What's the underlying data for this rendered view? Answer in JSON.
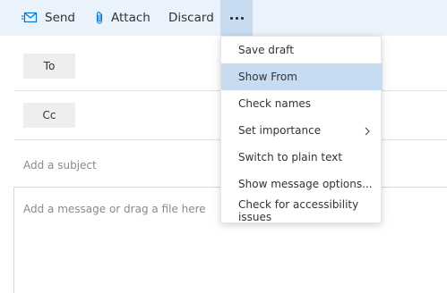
{
  "toolbar": {
    "send_label": "Send",
    "send_icon": "send-icon",
    "attach_label": "Attach",
    "attach_icon": "paperclip-icon",
    "discard_label": "Discard",
    "more_icon": "more-options-icon",
    "accent_color": "#0078d4",
    "background_color": "#eaf2fb"
  },
  "compose": {
    "to_label": "To",
    "cc_label": "Cc",
    "subject_placeholder": "Add a subject",
    "body_placeholder": "Add a message or drag a file here"
  },
  "menu": {
    "items": [
      {
        "label": "Save draft"
      },
      {
        "label": "Show From",
        "highlighted": true
      },
      {
        "label": "Check names"
      },
      {
        "label": "Set importance",
        "has_submenu": true
      },
      {
        "label": "Switch to plain text"
      },
      {
        "label": "Show message options..."
      },
      {
        "label": "Check for accessibility issues"
      }
    ],
    "highlight_color": "#c7dcf1"
  }
}
